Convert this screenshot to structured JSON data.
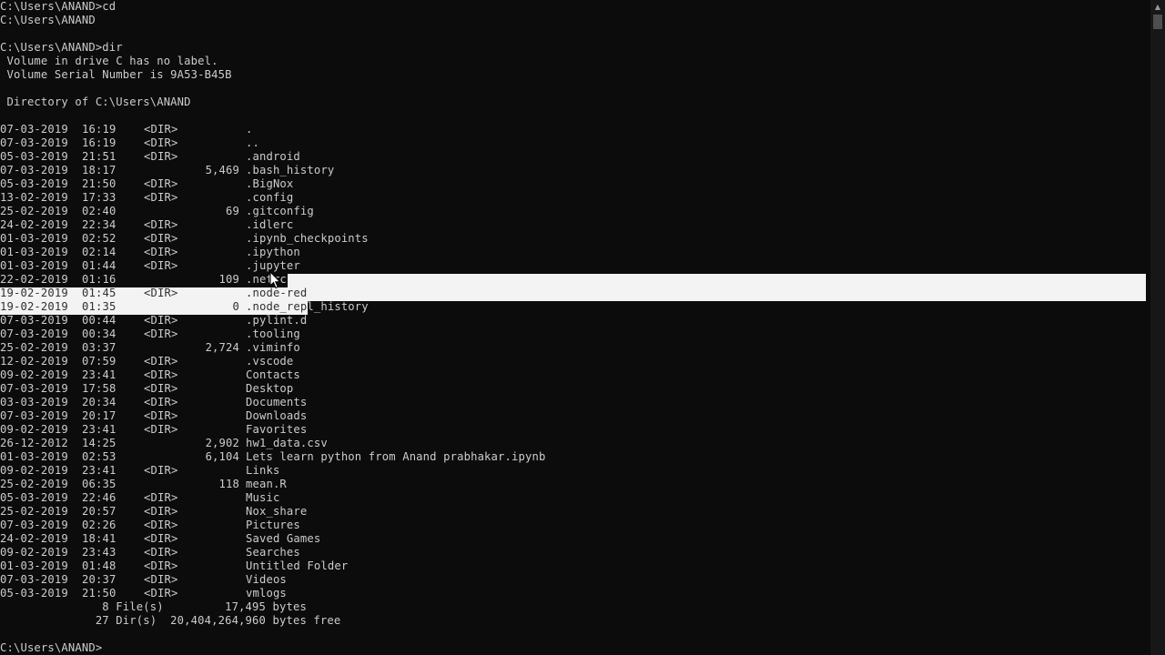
{
  "terminal": {
    "header_lines": [
      "C:\\Users\\ANAND>cd",
      "C:\\Users\\ANAND",
      "",
      "C:\\Users\\ANAND>dir",
      " Volume in drive C has no label.",
      " Volume Serial Number is 9A53-B45B",
      "",
      " Directory of C:\\Users\\ANAND",
      ""
    ],
    "entries": [
      {
        "date": "07-03-2019",
        "time": "16:19",
        "dir": "<DIR>",
        "size": "",
        "name": "."
      },
      {
        "date": "07-03-2019",
        "time": "16:19",
        "dir": "<DIR>",
        "size": "",
        "name": ".."
      },
      {
        "date": "05-03-2019",
        "time": "21:51",
        "dir": "<DIR>",
        "size": "",
        "name": ".android"
      },
      {
        "date": "07-03-2019",
        "time": "18:17",
        "dir": "",
        "size": "5,469",
        "name": ".bash_history"
      },
      {
        "date": "05-03-2019",
        "time": "21:50",
        "dir": "<DIR>",
        "size": "",
        "name": ".BigNox"
      },
      {
        "date": "13-02-2019",
        "time": "17:33",
        "dir": "<DIR>",
        "size": "",
        "name": ".config"
      },
      {
        "date": "25-02-2019",
        "time": "02:40",
        "dir": "",
        "size": "69",
        "name": ".gitconfig"
      },
      {
        "date": "24-02-2019",
        "time": "22:34",
        "dir": "<DIR>",
        "size": "",
        "name": ".idlerc"
      },
      {
        "date": "01-03-2019",
        "time": "02:52",
        "dir": "<DIR>",
        "size": "",
        "name": ".ipynb_checkpoints"
      },
      {
        "date": "01-03-2019",
        "time": "02:14",
        "dir": "<DIR>",
        "size": "",
        "name": ".ipython"
      },
      {
        "date": "01-03-2019",
        "time": "01:44",
        "dir": "<DIR>",
        "size": "",
        "name": ".jupyter"
      },
      {
        "date": "22-02-2019",
        "time": "01:16",
        "dir": "",
        "size": "109",
        "name": ".netrc"
      },
      {
        "date": "19-02-2019",
        "time": "01:45",
        "dir": "<DIR>",
        "size": "",
        "name": ".node-red"
      },
      {
        "date": "19-02-2019",
        "time": "01:35",
        "dir": "",
        "size": "0",
        "name": ".node_repl_history"
      },
      {
        "date": "07-03-2019",
        "time": "00:44",
        "dir": "<DIR>",
        "size": "",
        "name": ".pylint.d"
      },
      {
        "date": "07-03-2019",
        "time": "00:34",
        "dir": "<DIR>",
        "size": "",
        "name": ".tooling"
      },
      {
        "date": "25-02-2019",
        "time": "03:37",
        "dir": "",
        "size": "2,724",
        "name": ".viminfo"
      },
      {
        "date": "12-02-2019",
        "time": "07:59",
        "dir": "<DIR>",
        "size": "",
        "name": ".vscode"
      },
      {
        "date": "09-02-2019",
        "time": "23:41",
        "dir": "<DIR>",
        "size": "",
        "name": "Contacts"
      },
      {
        "date": "07-03-2019",
        "time": "17:58",
        "dir": "<DIR>",
        "size": "",
        "name": "Desktop"
      },
      {
        "date": "03-03-2019",
        "time": "20:34",
        "dir": "<DIR>",
        "size": "",
        "name": "Documents"
      },
      {
        "date": "07-03-2019",
        "time": "20:17",
        "dir": "<DIR>",
        "size": "",
        "name": "Downloads"
      },
      {
        "date": "09-02-2019",
        "time": "23:41",
        "dir": "<DIR>",
        "size": "",
        "name": "Favorites"
      },
      {
        "date": "26-12-2012",
        "time": "14:25",
        "dir": "",
        "size": "2,902",
        "name": "hw1_data.csv"
      },
      {
        "date": "01-03-2019",
        "time": "02:53",
        "dir": "",
        "size": "6,104",
        "name": "Lets learn python from Anand prabhakar.ipynb"
      },
      {
        "date": "09-02-2019",
        "time": "23:41",
        "dir": "<DIR>",
        "size": "",
        "name": "Links"
      },
      {
        "date": "25-02-2019",
        "time": "06:35",
        "dir": "",
        "size": "118",
        "name": "mean.R"
      },
      {
        "date": "05-03-2019",
        "time": "22:46",
        "dir": "<DIR>",
        "size": "",
        "name": "Music"
      },
      {
        "date": "25-02-2019",
        "time": "20:57",
        "dir": "<DIR>",
        "size": "",
        "name": "Nox_share"
      },
      {
        "date": "07-03-2019",
        "time": "02:26",
        "dir": "<DIR>",
        "size": "",
        "name": "Pictures"
      },
      {
        "date": "24-02-2019",
        "time": "18:41",
        "dir": "<DIR>",
        "size": "",
        "name": "Saved Games"
      },
      {
        "date": "09-02-2019",
        "time": "23:43",
        "dir": "<DIR>",
        "size": "",
        "name": "Searches"
      },
      {
        "date": "01-03-2019",
        "time": "01:48",
        "dir": "<DIR>",
        "size": "",
        "name": "Untitled Folder"
      },
      {
        "date": "07-03-2019",
        "time": "20:37",
        "dir": "<DIR>",
        "size": "",
        "name": "Videos"
      },
      {
        "date": "05-03-2019",
        "time": "21:50",
        "dir": "<DIR>",
        "size": "",
        "name": "vmlogs"
      }
    ],
    "summary": {
      "files": "               8 File(s)         17,495 bytes",
      "dirs": "              27 Dir(s)  20,404,264,960 bytes free"
    },
    "prompt": "C:\\Users\\ANAND>"
  },
  "colors": {
    "background": "#0c0c0c",
    "foreground": "#cccccc",
    "selection": "#ffffff"
  },
  "icons": {
    "scroll_up": "scroll-up-arrow-icon",
    "pointer": "mouse-pointer-icon"
  }
}
